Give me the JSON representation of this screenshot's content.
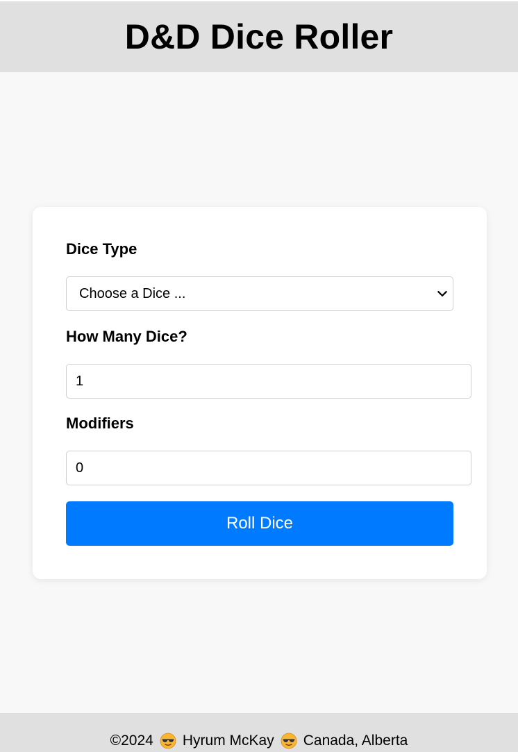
{
  "header": {
    "title": "D&D Dice Roller"
  },
  "form": {
    "dice_type_label": "Dice Type",
    "dice_type_selected": "Choose a Dice ...",
    "how_many_label": "How Many Dice?",
    "how_many_value": "1",
    "modifiers_label": "Modifiers",
    "modifiers_value": "0",
    "roll_button_label": "Roll Dice"
  },
  "footer": {
    "copyright": "©2024",
    "author": "Hyrum McKay",
    "location": "Canada, Alberta",
    "emoji_icon": "sunglasses-face-icon"
  },
  "colors": {
    "header_bg": "#e0e0e0",
    "page_bg": "#f8f8f8",
    "card_bg": "#ffffff",
    "accent": "#007bff"
  }
}
